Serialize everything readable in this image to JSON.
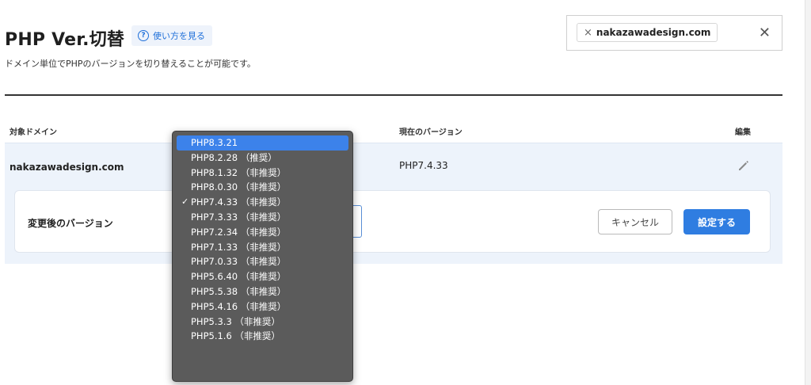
{
  "header": {
    "title": "PHP Ver.切替",
    "help_label": "使い方を見る",
    "description": "ドメイン単位でPHPのバージョンを切り替えることが可能です。"
  },
  "filter": {
    "chip_text": "nakazawadesign.com",
    "chip_remove": "×",
    "clear": "✕"
  },
  "table": {
    "columns": [
      "対象ドメイン",
      "現在のバージョン",
      "編集"
    ],
    "row": {
      "domain": "nakazawadesign.com",
      "current_version": "PHP7.4.33"
    }
  },
  "change_panel": {
    "label": "変更後のバージョン",
    "cancel_label": "キャンセル",
    "submit_label": "設定する"
  },
  "dropdown": {
    "highlighted_index": 0,
    "checked_index": 4,
    "check_mark": "✓",
    "options": [
      "PHP8.3.21",
      "PHP8.2.28 （推奨）",
      "PHP8.1.32 （非推奨）",
      "PHP8.0.30 （非推奨）",
      "PHP7.4.33 （非推奨）",
      "PHP7.3.33 （非推奨）",
      "PHP7.2.34 （非推奨）",
      "PHP7.1.33 （非推奨）",
      "PHP7.0.33 （非推奨）",
      "PHP5.6.40 （非推奨）",
      "PHP5.5.38 （非推奨）",
      "PHP5.4.16 （非推奨）",
      "PHP5.3.3 （非推奨）",
      "PHP5.1.6 （非推奨）"
    ]
  },
  "colors": {
    "accent": "#2f7de1",
    "row_background": "#edf3fb",
    "dropdown_background": "#5b5b5b",
    "dropdown_highlight": "#3c82ea"
  },
  "icons": {
    "help": "question-circle-icon",
    "edit": "pencil-icon",
    "check": "checkmark-icon"
  }
}
